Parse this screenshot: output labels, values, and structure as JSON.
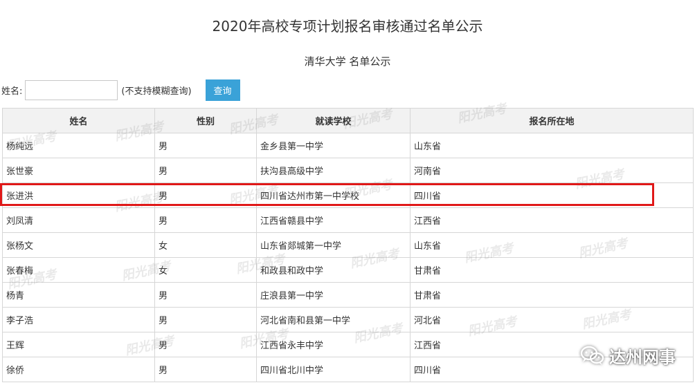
{
  "header": {
    "title": "2020年高校专项计划报名审核通过名单公示",
    "subtitle": "清华大学 名单公示"
  },
  "search": {
    "label": "姓名:",
    "value": "",
    "placeholder": "",
    "hint": "(不支持模糊查询)",
    "button_label": "查询"
  },
  "table": {
    "headers": [
      "姓名",
      "性别",
      "就读学校",
      "报名所在地"
    ],
    "rows": [
      [
        "杨纯远",
        "男",
        "金乡县第一中学",
        "山东省"
      ],
      [
        "张世豪",
        "男",
        "扶沟县高级中学",
        "河南省"
      ],
      [
        "张进洪",
        "男",
        "四川省达州市第一中学校",
        "四川省"
      ],
      [
        "刘凤清",
        "男",
        "江西省赣县中学",
        "江西省"
      ],
      [
        "张杨文",
        "女",
        "山东省郯城第一中学",
        "山东省"
      ],
      [
        "张春梅",
        "女",
        "和政县和政中学",
        "甘肃省"
      ],
      [
        "杨青",
        "男",
        "庄浪县第一中学",
        "甘肃省"
      ],
      [
        "李子浩",
        "男",
        "河北省南和县第一中学",
        "河北省"
      ],
      [
        "王辉",
        "男",
        "江西省永丰中学",
        "江西省"
      ],
      [
        "徐侨",
        "男",
        "四川省北川中学",
        "四川省"
      ]
    ]
  },
  "watermark": {
    "text": "阳光高考"
  },
  "badge": {
    "text": "达州网事",
    "icon": "wechat-icon"
  },
  "colors": {
    "highlight": "#e01818",
    "button": "#3aa2d8"
  }
}
